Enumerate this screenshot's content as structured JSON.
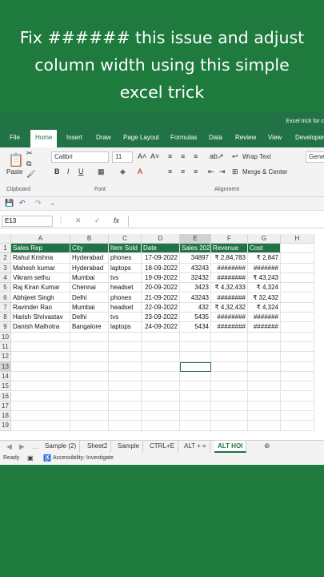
{
  "caption": {
    "line1": "Fix ###### this issue and adjust",
    "line2": "column width using this simple",
    "line3": "excel trick"
  },
  "window": {
    "title": "Excel trick for c"
  },
  "ribbon_tabs": [
    "File",
    "Home",
    "Insert",
    "Draw",
    "Page Layout",
    "Formulas",
    "Data",
    "Review",
    "View",
    "Developer"
  ],
  "ribbon": {
    "paste": "Paste",
    "font_name": "Calibri",
    "font_size": "11",
    "wrap_text": "Wrap Text",
    "merge_center": "Merge & Center",
    "number_format": "Gener",
    "groups": {
      "clipboard": "Clipboard",
      "font": "Font",
      "alignment": "Alignment"
    }
  },
  "formula_bar": {
    "name_box": "E13",
    "fx": "fx"
  },
  "columns": [
    "A",
    "B",
    "C",
    "D",
    "E",
    "F",
    "G",
    "H"
  ],
  "rows": [
    "1",
    "2",
    "3",
    "4",
    "5",
    "6",
    "7",
    "8",
    "9",
    "10",
    "11",
    "12",
    "13",
    "14",
    "15",
    "16",
    "17",
    "18",
    "19"
  ],
  "table": {
    "headers": [
      "Sales Rep",
      "City",
      "Item Sold",
      "Date",
      "Sales 202",
      "Revenue",
      "Cost"
    ],
    "rows": [
      [
        "Rahul Krishna",
        "Hyderabad",
        "phones",
        "17-09-2022",
        "34897",
        "₹ 2,84,783",
        "₹   2,847"
      ],
      [
        "Mahesh kumar",
        "Hyderabad",
        "laptops",
        "18-09-2022",
        "43243",
        "########",
        "#######"
      ],
      [
        "Vikram sethu",
        "Mumbai",
        "tvs",
        "19-09-2022",
        "32432",
        "########",
        "₹ 43,243"
      ],
      [
        "Raj Kiran Kumar",
        "Chennai",
        "headset",
        "20-09-2022",
        "3423",
        "₹ 4,32,433",
        "₹   4,324"
      ],
      [
        "Abhijeet Singh",
        "Delhi",
        "phones",
        "21-09-2022",
        "43243",
        "########",
        "₹ 32,432"
      ],
      [
        "Ravinder Rao",
        "Mumbai",
        "headset",
        "22-09-2022",
        "432",
        "₹ 4,32,432",
        "₹   4,324"
      ],
      [
        "Harish Shrivastav",
        "Delhi",
        "tvs",
        "23-09-2022",
        "5435",
        "########",
        "#######"
      ],
      [
        "Danish Malhotra",
        "Bangalore",
        "laptops",
        "24-09-2022",
        "5434",
        "########",
        "#######"
      ]
    ]
  },
  "sheet_tabs": [
    "Sample (2)",
    "Sheet2",
    "Sample",
    "CTRL+E",
    "ALT + =",
    "ALT HOI"
  ],
  "active_sheet": "ALT HOI",
  "status": {
    "ready": "Ready",
    "accessibility": "Accessibility: Investigate"
  },
  "colors": {
    "excel_green": "#217346",
    "background": "#1f7a3e"
  }
}
